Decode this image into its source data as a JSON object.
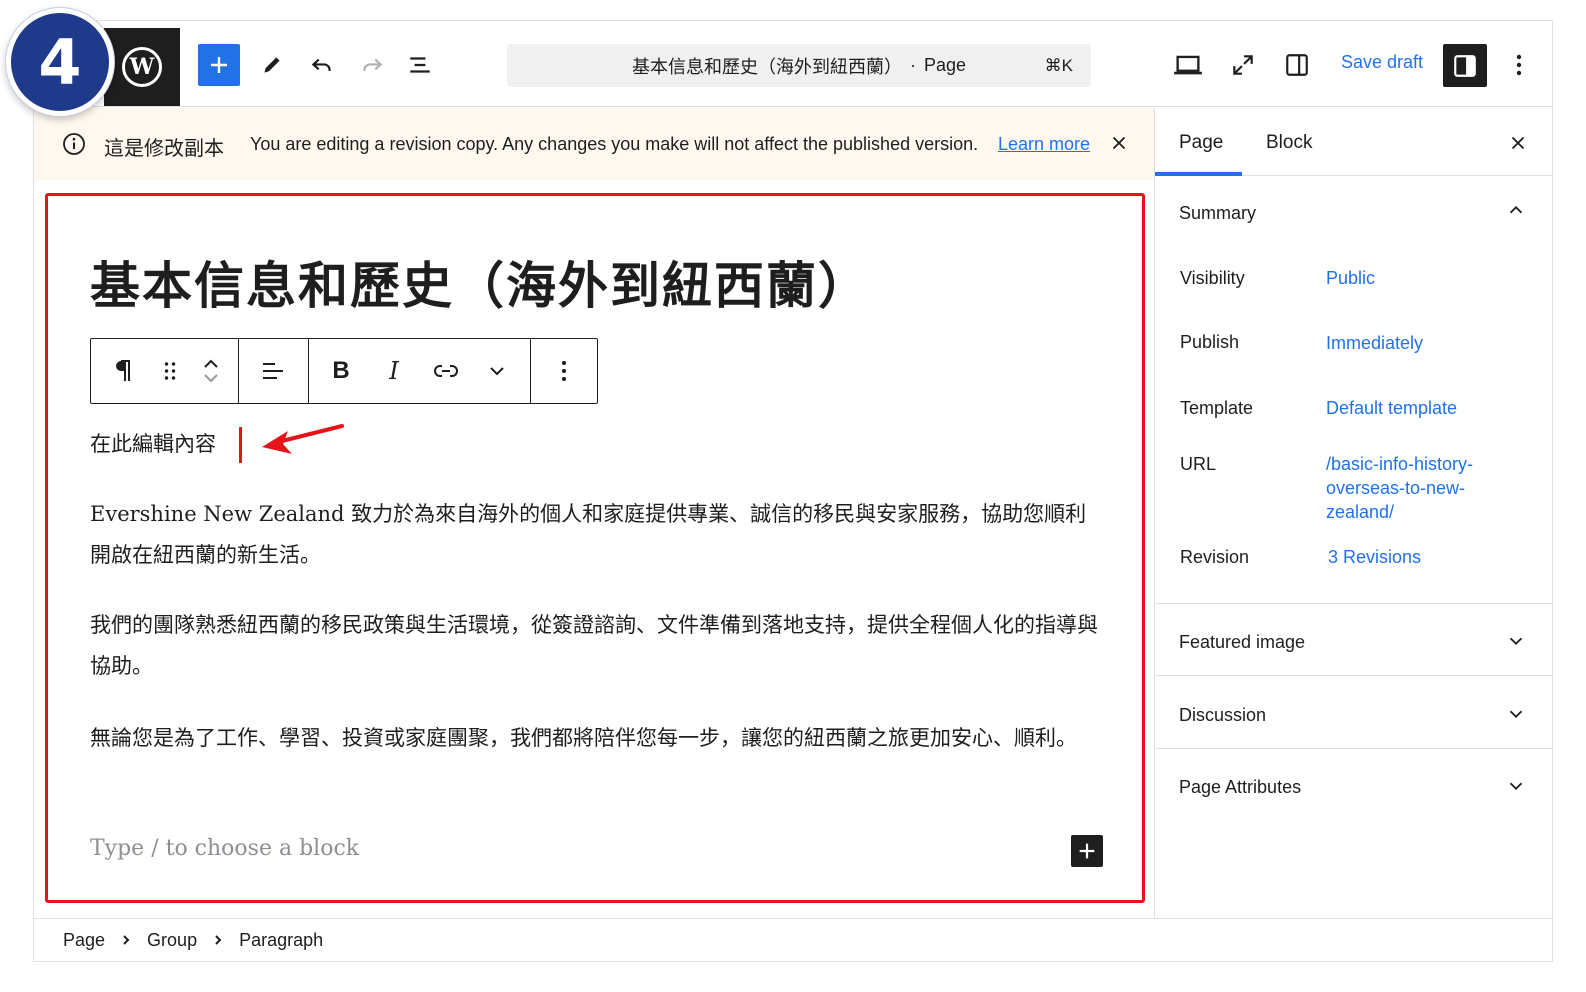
{
  "step": {
    "number": "4"
  },
  "header": {
    "document_title": "基本信息和歷史（海外到紐西蘭）",
    "separator": "·",
    "document_type": "Page",
    "shortcut": "⌘K",
    "save_draft_label": "Save draft"
  },
  "notice": {
    "zh_label": "這是修改副本",
    "message": "You are editing a revision copy. Any changes you make will not affect the published version.",
    "learn_more": "Learn more"
  },
  "content": {
    "title": "基本信息和歷史（海外到紐西蘭）",
    "edit_hint": "在此編輯內容",
    "paragraphs": [
      "Evershine New Zealand 致力於為來自海外的個人和家庭提供專業、誠信的移民與安家服務，協助您順利開啟在紐西蘭的新生活。",
      "我們的團隊熟悉紐西蘭的移民政策與生活環境，從簽證諮詢、文件準備到落地支持，提供全程個人化的指導與協助。",
      "無論您是為了工作、學習、投資或家庭團聚，我們都將陪伴您每一步，讓您的紐西蘭之旅更加安心、順利。"
    ],
    "placeholder": "Type / to choose a block"
  },
  "block_toolbar": {
    "bold": "B",
    "italic": "I"
  },
  "breadcrumb": [
    "Page",
    "Group",
    "Paragraph"
  ],
  "sidebar": {
    "tabs": [
      "Page",
      "Block"
    ],
    "summary": {
      "title": "Summary",
      "rows": [
        {
          "label": "Visibility",
          "value": "Public"
        },
        {
          "label": "Publish",
          "value": "Immediately"
        },
        {
          "label": "Template",
          "value": "Default template"
        },
        {
          "label": "URL",
          "value": "/basic-info-history-overseas-to-new-zealand/"
        },
        {
          "label": "Revision",
          "value": "3 Revisions"
        }
      ]
    },
    "panels": [
      "Featured image",
      "Discussion",
      "Page Attributes"
    ]
  },
  "colors": {
    "accent": "#2271e6",
    "highlight": "#e5141b",
    "badge": "#1f3a8a",
    "notice_bg": "#fef8ee"
  }
}
